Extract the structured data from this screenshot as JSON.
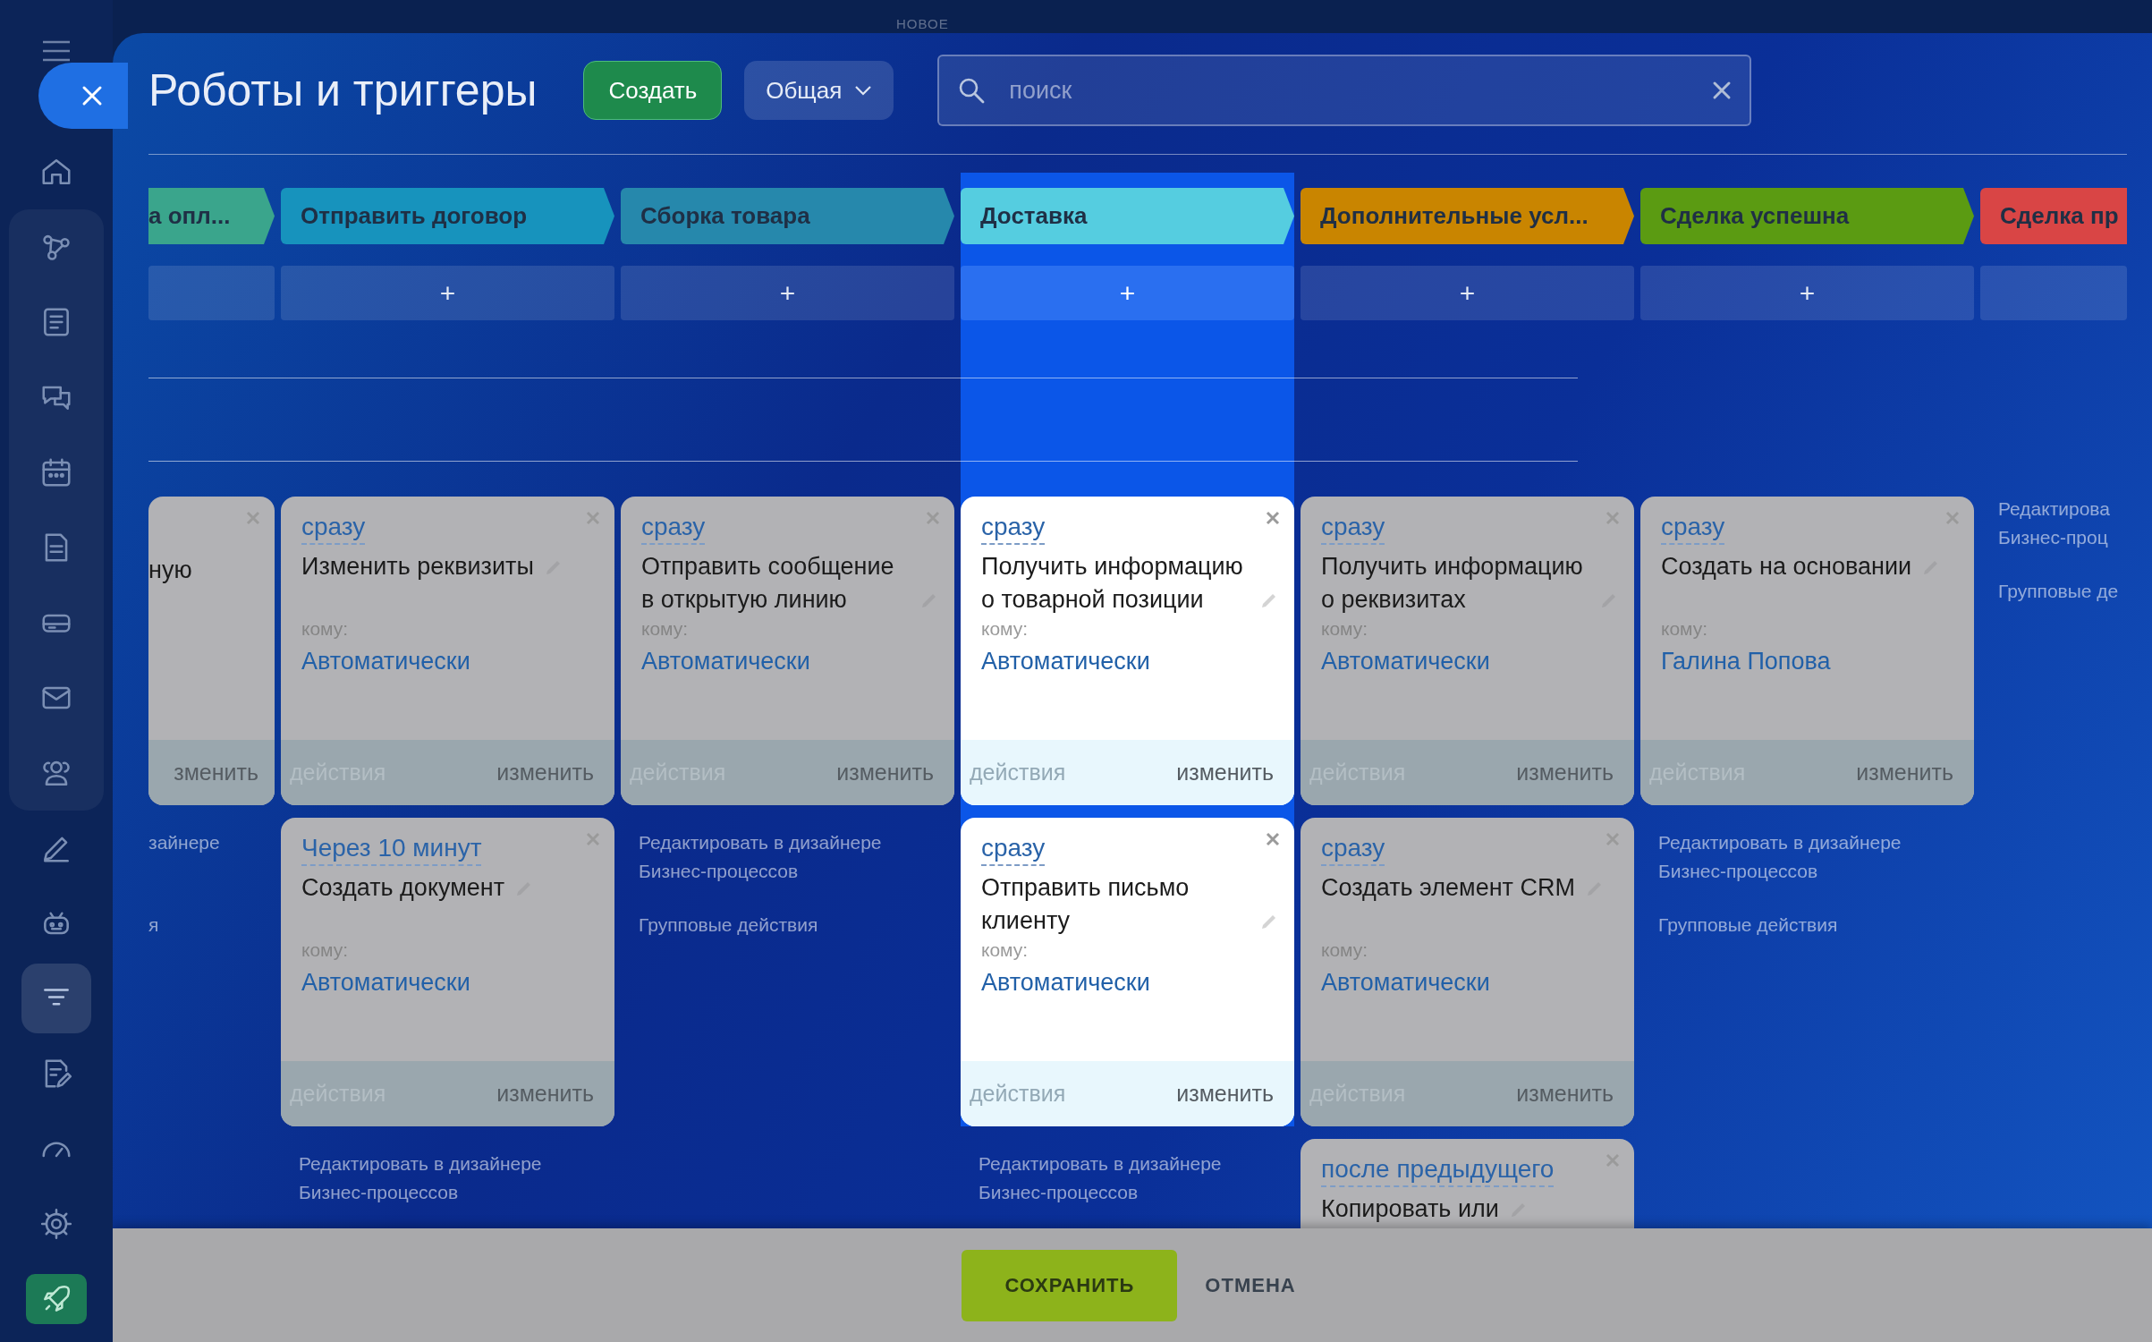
{
  "top_label": "НОВОЕ",
  "sidebar": {
    "sections": [
      {
        "grouped": false,
        "items": [
          {
            "kind": "home",
            "selected": false
          }
        ]
      },
      {
        "grouped": true,
        "items": [
          {
            "kind": "nodes",
            "selected": false
          },
          {
            "kind": "news",
            "selected": false
          },
          {
            "kind": "chat",
            "selected": false
          },
          {
            "kind": "calendar",
            "selected": false
          },
          {
            "kind": "document",
            "selected": false
          },
          {
            "kind": "drive",
            "selected": false
          },
          {
            "kind": "mail",
            "selected": false
          },
          {
            "kind": "people",
            "selected": false
          }
        ]
      },
      {
        "grouped": false,
        "items": [
          {
            "kind": "pen",
            "selected": false
          },
          {
            "kind": "robot",
            "selected": false
          },
          {
            "kind": "filter",
            "selected": true
          },
          {
            "kind": "doc-edit",
            "selected": false
          },
          {
            "kind": "gauge",
            "selected": false
          },
          {
            "kind": "gear",
            "selected": false
          },
          {
            "kind": "rocket",
            "selected": false
          }
        ]
      }
    ]
  },
  "header": {
    "title": "Роботы и триггеры",
    "create_button": "Создать",
    "view_button": "Общая",
    "search": {
      "placeholder": "поиск"
    }
  },
  "columns": [
    {
      "kind": "edge-left",
      "selected": false,
      "stage": {
        "label": "а опл...",
        "color": "#3aa58c"
      },
      "cards": [
        {
          "kind": "clipped",
          "title": "ную",
          "edit_label": "зменить"
        }
      ],
      "links": [
        {
          "kind": "designer",
          "text": "зайнере"
        },
        {
          "kind": "group",
          "text": "я"
        }
      ]
    },
    {
      "kind": "full",
      "selected": false,
      "stage": {
        "label": "Отправить договор",
        "color": "#1793bd"
      },
      "add_label": "+",
      "cards": [
        {
          "kind": "full",
          "delay": "сразу",
          "title": "Изменить реквизиты",
          "recipient_label": "кому:",
          "recipient": "Автоматически",
          "actions_label": "действия",
          "edit_label": "изменить"
        },
        {
          "kind": "full",
          "delay": "Через 10 минут",
          "title": "Создать документ",
          "recipient_label": "кому:",
          "recipient": "Автоматически",
          "actions_label": "действия",
          "edit_label": "изменить"
        }
      ],
      "links": [
        {
          "kind": "designer",
          "text": "Редактировать в дизайнере\nБизнес-процессов"
        }
      ]
    },
    {
      "kind": "full",
      "selected": false,
      "stage": {
        "label": "Сборка товара",
        "color": "#2688ac"
      },
      "add_label": "+",
      "cards": [
        {
          "kind": "full",
          "delay": "сразу",
          "title": "Отправить сообщение в открытую линию",
          "recipient_label": "кому:",
          "recipient": "Автоматически",
          "actions_label": "действия",
          "edit_label": "изменить"
        }
      ],
      "links": [
        {
          "kind": "designer",
          "text": "Редактировать в дизайнере\nБизнес-процессов"
        },
        {
          "kind": "group",
          "text": "Групповые действия"
        }
      ]
    },
    {
      "kind": "full",
      "selected": true,
      "stage": {
        "label": "Доставка",
        "color": "#55cde0"
      },
      "add_label": "+",
      "cards": [
        {
          "kind": "full",
          "delay": "сразу",
          "title": "Получить информацию о товарной позиции",
          "recipient_label": "кому:",
          "recipient": "Автоматически",
          "actions_label": "действия",
          "edit_label": "изменить"
        },
        {
          "kind": "full",
          "delay": "сразу",
          "title": "Отправить письмо клиенту",
          "recipient_label": "кому:",
          "recipient": "Автоматически",
          "actions_label": "действия",
          "edit_label": "изменить"
        }
      ],
      "links": [
        {
          "kind": "designer",
          "text": "Редактировать в дизайнере\nБизнес-процессов"
        }
      ]
    },
    {
      "kind": "full",
      "selected": false,
      "stage": {
        "label": "Дополнительные усл...",
        "color": "#c98500"
      },
      "add_label": "+",
      "cards": [
        {
          "kind": "full",
          "delay": "сразу",
          "title": "Получить информацию о реквизитах",
          "recipient_label": "кому:",
          "recipient": "Автоматически",
          "actions_label": "действия",
          "edit_label": "изменить"
        },
        {
          "kind": "full",
          "delay": "сразу",
          "title": "Создать элемент CRM",
          "recipient_label": "кому:",
          "recipient": "Автоматически",
          "actions_label": "действия",
          "edit_label": "изменить"
        },
        {
          "kind": "full",
          "delay": "после предыдущего",
          "title": "Копировать или"
        }
      ]
    },
    {
      "kind": "full",
      "selected": false,
      "stage": {
        "label": "Сделка успешна",
        "color": "#5b9b12"
      },
      "add_label": "+",
      "cards": [
        {
          "kind": "full",
          "delay": "сразу",
          "title": "Создать на основании",
          "recipient_label": "кому:",
          "recipient": "Галина Попова",
          "actions_label": "действия",
          "edit_label": "изменить"
        }
      ],
      "links": [
        {
          "kind": "designer",
          "text": "Редактировать в дизайнере\nБизнес-процессов"
        },
        {
          "kind": "group",
          "text": "Групповые действия"
        }
      ]
    },
    {
      "kind": "edge-right",
      "selected": false,
      "stage": {
        "label": "Сделка пр",
        "color": "#d94545"
      },
      "links": [
        {
          "kind": "designer",
          "text": "Редактирова\nБизнес-проц"
        },
        {
          "kind": "group",
          "text": "Групповые де"
        }
      ]
    }
  ],
  "footer": {
    "save_button": "СОХРАНИТЬ",
    "cancel_button": "ОТМЕНА"
  }
}
